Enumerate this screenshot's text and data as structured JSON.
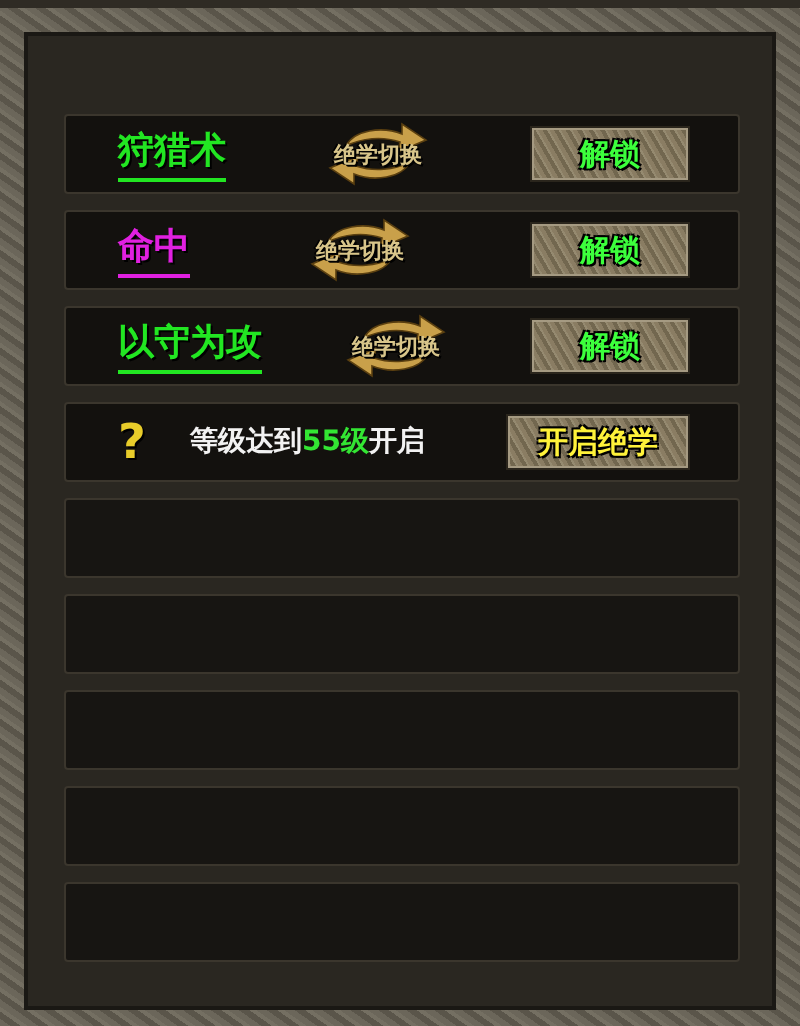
{
  "rows": [
    {
      "kind": "skill",
      "name": "狩猎术",
      "color": "#22e622",
      "switch_label": "绝学切换",
      "button": "解锁"
    },
    {
      "kind": "skill",
      "name": "命中",
      "color": "#e020e0",
      "switch_label": "绝学切换",
      "button": "解锁"
    },
    {
      "kind": "skill",
      "name": "以守为攻",
      "color": "#22e622",
      "switch_label": "绝学切换",
      "button": "解锁"
    },
    {
      "kind": "locked",
      "mark": "?",
      "text_before": "等级达到",
      "level_text": "55级",
      "text_after": "开启",
      "button": "开启绝学"
    },
    {
      "kind": "empty"
    },
    {
      "kind": "empty"
    },
    {
      "kind": "empty"
    },
    {
      "kind": "empty"
    },
    {
      "kind": "empty"
    }
  ]
}
